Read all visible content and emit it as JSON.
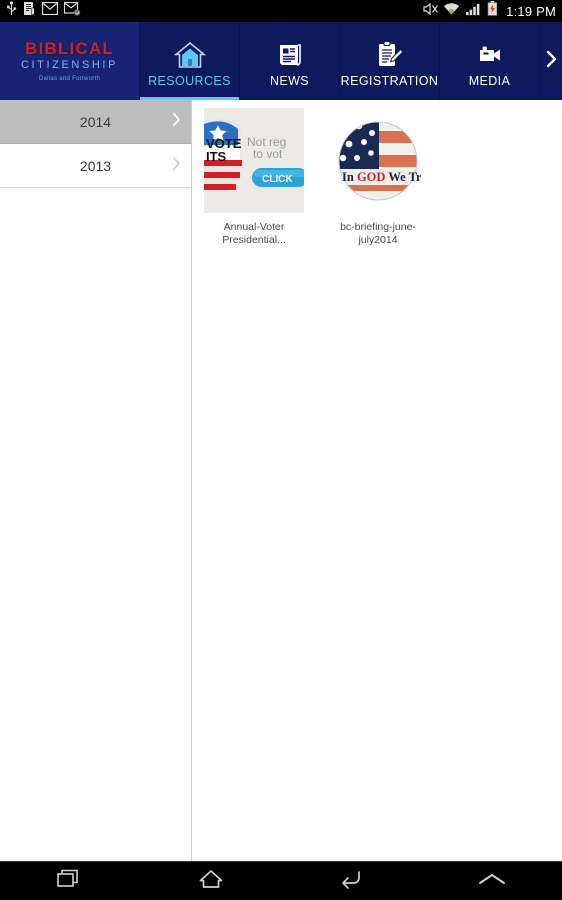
{
  "status_bar": {
    "icons": [
      "usb-icon",
      "document-alert-icon",
      "gmail-icon",
      "email-sync-icon"
    ],
    "right_icons": [
      "mute-icon",
      "wifi-icon",
      "cellular-signal-icon",
      "battery-charging-icon"
    ],
    "time": "1:19 PM"
  },
  "header": {
    "logo": {
      "line1": "BIBLICAL",
      "line2": "CITIZENSHIP",
      "subtitle": "Dallas and Fortworth",
      "color_line1": "#cf2027",
      "color_line2": "#7fb8e8"
    },
    "active_color": "#5bc8f5",
    "background": "#0d1a5e",
    "tabs": [
      {
        "label": "RESOURCES",
        "icon": "home-icon",
        "active": true
      },
      {
        "label": "NEWS",
        "icon": "newspaper-icon",
        "active": false
      },
      {
        "label": "REGISTRATION",
        "icon": "clipboard-pencil-icon",
        "active": false
      },
      {
        "label": "MEDIA",
        "icon": "video-camera-icon",
        "active": false
      }
    ],
    "scroll_arrow": "chevron-right-icon"
  },
  "sidebar": {
    "items": [
      {
        "label": "2014",
        "selected": true,
        "chevron": "chevron-right-icon"
      },
      {
        "label": "2013",
        "selected": false,
        "chevron": "chevron-right-icon"
      }
    ]
  },
  "content": {
    "items": [
      {
        "caption": "Annual-Voter Presidential...",
        "thumbnail": "vote-badge-register-thumbnail",
        "thumb_text": {
          "line1": "Not reg",
          "line2": "to vot",
          "button": "CLICK",
          "badge_top": "VOTE",
          "badge_bottom": "ITS"
        }
      },
      {
        "caption": "bc-briefing-june-july2014",
        "thumbnail": "american-flag-circle-thumbnail",
        "thumb_text": {
          "motto_1": "In ",
          "motto_2": "GOD",
          "motto_3": " We Trust"
        }
      }
    ]
  },
  "system_bar": {
    "buttons": [
      {
        "name": "recents-button",
        "icon": "recents-icon"
      },
      {
        "name": "home-button",
        "icon": "home-outline-icon"
      },
      {
        "name": "back-button",
        "icon": "back-arrow-icon"
      },
      {
        "name": "expand-button",
        "icon": "chevron-up-icon"
      }
    ]
  }
}
